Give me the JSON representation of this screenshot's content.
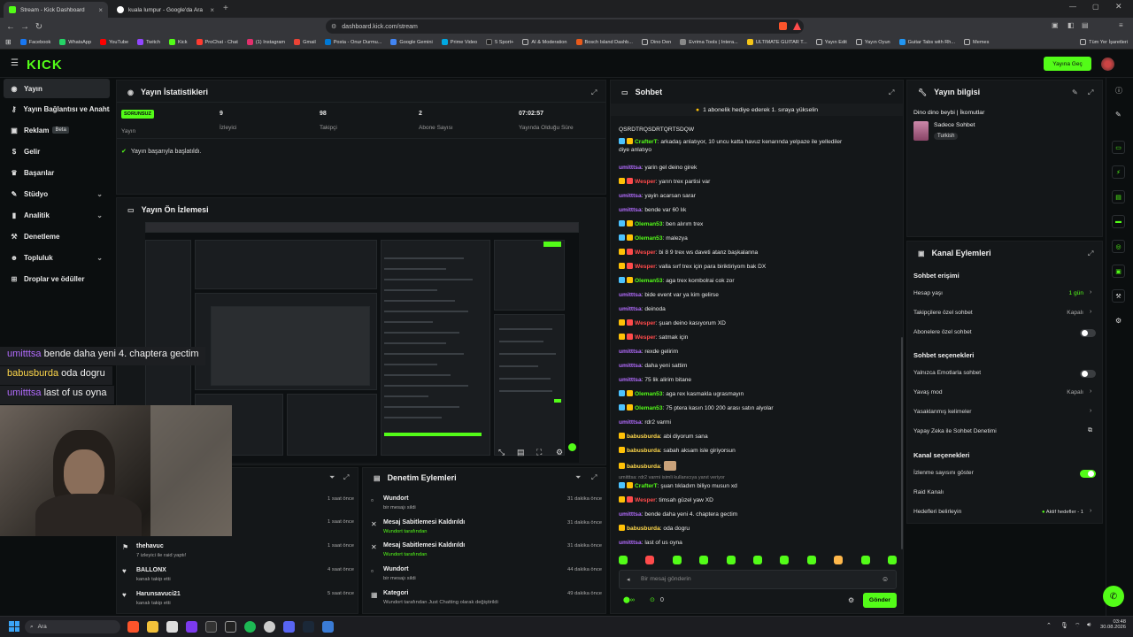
{
  "browser": {
    "tabs": [
      {
        "title": "Stream - Kick Dashboard",
        "active": true
      },
      {
        "title": "kuala lumpur - Google'da Ara",
        "active": false
      }
    ],
    "url": "dashboard.kick.com/stream",
    "bookmarks": [
      "Facebook",
      "WhatsApp",
      "YouTube",
      "Twitch",
      "Kick",
      "ProChat - Chat",
      "(1) Instagram",
      "Gmail",
      "Posta - Onur Durmu...",
      "Google Gemini",
      "Prime Video",
      "5 Sport+",
      "AI & Moderation",
      "Bosch Island Dashb...",
      "Dino Den",
      "Evrima Tools | Intera...",
      "ULTIMATE GUITAR T...",
      "Yayın Edit",
      "Yayın Oyun",
      "Guitar Tabs with Rh...",
      "Memes"
    ],
    "bookmarks_all": "Tüm Yer İşaretleri"
  },
  "kick": {
    "logo": "KICK",
    "go_live": "Yayına Geç"
  },
  "sidebar": {
    "items": [
      {
        "label": "Yayın",
        "active": true
      },
      {
        "label": "Yayın Bağlantısı ve Anahtarı"
      },
      {
        "label": "Reklam",
        "badge": "Beta"
      },
      {
        "label": "Gelir"
      },
      {
        "label": "Başarılar"
      },
      {
        "label": "Stüdyo",
        "chevron": true
      },
      {
        "label": "Analitik",
        "chevron": true
      },
      {
        "label": "Denetleme"
      },
      {
        "label": "Topluluk",
        "chevron": true
      },
      {
        "label": "Droplar ve ödüller"
      }
    ]
  },
  "stats": {
    "title": "Yayın İstatistikleri",
    "status_badge": "SORUNSUZ",
    "items": [
      {
        "value": "",
        "label": "Yayın"
      },
      {
        "value": "9",
        "label": "İzleyici"
      },
      {
        "value": "98",
        "label": "Takipçi"
      },
      {
        "value": "2",
        "label": "Abone Sayısı"
      },
      {
        "value": "07:02:57",
        "label": "Yayında Olduğu Süre"
      }
    ],
    "success_msg": "Yayın başarıyla başlatıldı."
  },
  "preview": {
    "title": "Yayın Ön İzlemesi"
  },
  "overlay_chat": [
    {
      "user": "umitttsa",
      "text": "bende daha yeni 4. chaptera gectim"
    },
    {
      "user": "babusburda",
      "text": "oda dogru"
    },
    {
      "user": "umitttsa",
      "text": "last of us oyna"
    }
  ],
  "activity": {
    "items": [
      {
        "name": "",
        "sub": "",
        "time": "1 saat önce"
      },
      {
        "name": "",
        "sub": "",
        "time": "1 saat önce"
      },
      {
        "name": "thehavuc",
        "sub": "7 izleyici ile raid yaptı!",
        "time": "1 saat önce"
      },
      {
        "name": "BALLONX",
        "sub": "kanalı takip etti",
        "time": "4 saat önce"
      },
      {
        "name": "Harunsavuci21",
        "sub": "kanalı takip etti",
        "time": "5 saat önce"
      }
    ]
  },
  "mod_actions": {
    "title": "Denetim Eylemleri",
    "items": [
      {
        "name": "Wundort",
        "sub": "bir mesajı sildi",
        "time": "31 dakika önce"
      },
      {
        "name": "Mesaj Sabitlemesi Kaldırıldı",
        "sub": "Wundort tarafından",
        "time": "31 dakika önce"
      },
      {
        "name": "Mesaj Sabitlemesi Kaldırıldı",
        "sub": "Wundort tarafından",
        "time": "31 dakika önce"
      },
      {
        "name": "Wundort",
        "sub": "bir mesajı sildi",
        "time": "44 dakika önce"
      },
      {
        "name": "Kategori",
        "sub": "Wundort tarafından Just Chatting olarak değiştirildi",
        "time": "49 dakika önce"
      }
    ]
  },
  "chat": {
    "title": "Sohbet",
    "banner": "1 abonelik hediye ederek 1. sıraya yükselin",
    "messages": [
      {
        "user": "",
        "text": "QSRDTRQSDRTQRTSDQW",
        "color": "pur"
      },
      {
        "user": "CrafterT",
        "text": ": arkadaş anlatıyor, 10 uncu katta havuz kenarında yelpaze ile yellediler",
        "color": "grn",
        "cont": "diye anlatıyo"
      },
      {
        "user": "umitttsa",
        "text": ": yarin gel deino girek",
        "color": "pur"
      },
      {
        "user": "Wesper",
        "text": ": yarın trex partisi var",
        "color": "red"
      },
      {
        "user": "umitttsa",
        "text": ": yayin acarsan sarar",
        "color": "pur"
      },
      {
        "user": "umitttsa",
        "text": ": bende var 60 lık",
        "color": "pur"
      },
      {
        "user": "Oleman53",
        "text": ": ben alırım trex",
        "color": "grn"
      },
      {
        "user": "Oleman53",
        "text": ": malezya",
        "color": "grn"
      },
      {
        "user": "Wesper",
        "text": ": bi 8 9 trex ws daveti atanz başkalanna",
        "color": "red"
      },
      {
        "user": "Wesper",
        "text": ": valla sırf trex için para biriktiriyom bak DX",
        "color": "red"
      },
      {
        "user": "Oleman53",
        "text": ": aga trex kombolrai cok zor",
        "color": "grn"
      },
      {
        "user": "umitttsa",
        "text": ": bide event var ya kim gelirse",
        "color": "pur"
      },
      {
        "user": "umitttsa",
        "text": ": deinoda",
        "color": "pur"
      },
      {
        "user": "Wesper",
        "text": ": şuan deino kasıyorum XD",
        "color": "red"
      },
      {
        "user": "Wesper",
        "text": ": satmak için",
        "color": "red"
      },
      {
        "user": "umitttsa",
        "text": ": rexde gelirim",
        "color": "pur"
      },
      {
        "user": "umitttsa",
        "text": ": daha yeni sattim",
        "color": "pur"
      },
      {
        "user": "umitttsa",
        "text": ": 75 lik alirim bitane",
        "color": "pur"
      },
      {
        "user": "Oleman53",
        "text": ": aga rex kasmakla ugrasmayın",
        "color": "grn"
      },
      {
        "user": "Oleman53",
        "text": ": 75 ptera kasın 100 200 arası satın alyolar",
        "color": "grn"
      },
      {
        "user": "umitttsa",
        "text": ": rdr2 varmi",
        "color": "pur"
      },
      {
        "user": "babusburda",
        "text": ": abi diyorum sana",
        "color": "yel"
      },
      {
        "user": "babusburda",
        "text": ": sabah aksam isle giriyorsun",
        "color": "yel"
      },
      {
        "user": "babusburda",
        "text": ":",
        "color": "yel"
      },
      {
        "user": "",
        "text": "umitttsa: rdr2 varmi isimli kullanıcıya yanıt veriyor",
        "color": "reply"
      },
      {
        "user": "CrafterT",
        "text": ": şuan tıkladım biliyo musun xd",
        "color": "grn"
      },
      {
        "user": "Wesper",
        "text": ": timsah güzel yaw XD",
        "color": "red"
      },
      {
        "user": "umitttsa",
        "text": ": bende daha yeni 4. chaptera gectim",
        "color": "pur"
      },
      {
        "user": "babusburda",
        "text": ": oda dogru",
        "color": "yel"
      },
      {
        "user": "umitttsa",
        "text": ": last of us oyna",
        "color": "pur"
      }
    ],
    "input_placeholder": "Bir mesaj gönderin",
    "send_label": "Gönder",
    "points": "0"
  },
  "stream_info": {
    "title": "Yayın bilgisi",
    "stream_title": "Dino dino beybi | İkomutlar",
    "category": "Sadece Sohbet",
    "language": "Turkish"
  },
  "channel_actions": {
    "title": "Kanal Eylemleri",
    "chat_access": "Sohbet erişimi",
    "account_age": "Hesap yaşı",
    "account_age_val": "1 gün",
    "followers_chat": "Takipçilere özel sohbet",
    "followers_chat_val": "Kapalı",
    "subs_chat": "Abonelere özel sohbet",
    "chat_options": "Sohbet seçenekleri",
    "emotes_only": "Yalnızca Emotlarla sohbet",
    "slow_mode": "Yavaş mod",
    "slow_mode_val": "Kapalı",
    "banned_words": "Yasaklanmış kelimeler",
    "ai_mod": "Yapay Zeka ile Sohbet Denetimi",
    "channel_options": "Kanal seçenekleri",
    "show_viewers": "İzlenme sayısını göster",
    "raid": "Raid Kanalı",
    "goals": "Hedefleri belirleyin",
    "goals_val": "Aktif hedefler - 1"
  },
  "taskbar": {
    "search": "Ara",
    "time": "03:48",
    "date": "30.08.2026"
  },
  "colors": {
    "accent": "#53fc18",
    "bg": "#0b0e0f",
    "panel": "#141719"
  }
}
